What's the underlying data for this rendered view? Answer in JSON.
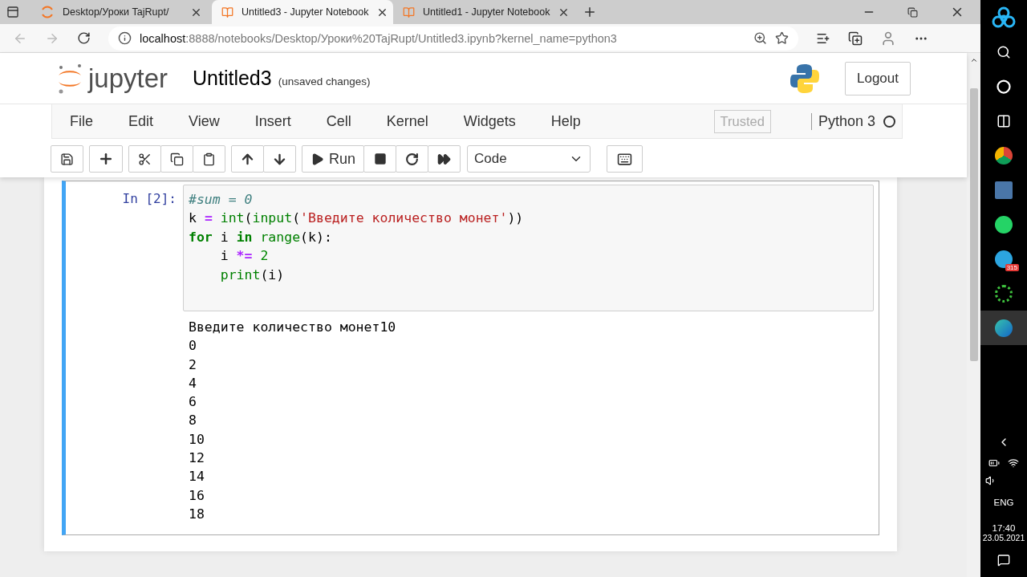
{
  "browser": {
    "tabs": [
      {
        "title": "Desktop/Уроки TajRupt/",
        "selected": false,
        "kind": "loading"
      },
      {
        "title": "Untitled3 - Jupyter Notebook",
        "selected": true,
        "kind": "notebook"
      },
      {
        "title": "Untitled1 - Jupyter Notebook",
        "selected": false,
        "kind": "notebook"
      }
    ],
    "url": {
      "host": "localhost",
      "rest": ":8888/notebooks/Desktop/Уроки%20TajRupt/Untitled3.ipynb?kernel_name=python3"
    }
  },
  "header": {
    "logo_text": "jupyter",
    "notebook_name": "Untitled3",
    "save_status": "(unsaved changes)",
    "logout": "Logout"
  },
  "menu": [
    "File",
    "Edit",
    "View",
    "Insert",
    "Cell",
    "Kernel",
    "Widgets",
    "Help"
  ],
  "trusted": "Trusted",
  "kernel": {
    "name": "Python 3",
    "busy": false
  },
  "toolbar": {
    "run": "Run",
    "cell_type": "Code"
  },
  "cell": {
    "prompt": "In [2]:",
    "selected": true,
    "code": [
      [
        {
          "kind": "comment",
          "text": "#sum = 0"
        }
      ],
      [
        {
          "kind": "plain",
          "text": "k "
        },
        {
          "kind": "operator",
          "text": "="
        },
        {
          "kind": "builtin",
          "text": " int"
        },
        {
          "kind": "plain",
          "text": "("
        },
        {
          "kind": "builtin",
          "text": "input"
        },
        {
          "kind": "plain",
          "text": "("
        },
        {
          "kind": "string",
          "text": "'Введите количество монет'"
        },
        {
          "kind": "plain",
          "text": "))"
        }
      ],
      [
        {
          "kind": "keyword",
          "text": "for"
        },
        {
          "kind": "plain",
          "text": " i "
        },
        {
          "kind": "keyword",
          "text": "in"
        },
        {
          "kind": "builtin",
          "text": " range"
        },
        {
          "kind": "plain",
          "text": "(k):"
        }
      ],
      [
        {
          "kind": "plain",
          "text": "    i "
        },
        {
          "kind": "operator",
          "text": "*="
        },
        {
          "kind": "number",
          "text": " 2"
        }
      ],
      [
        {
          "kind": "builtin",
          "text": "    print"
        },
        {
          "kind": "plain",
          "text": "(i)"
        }
      ]
    ],
    "output": [
      "Введите количество монет10",
      "0",
      "2",
      "4",
      "6",
      "8",
      "10",
      "12",
      "14",
      "16",
      "18"
    ]
  },
  "taskbar": {
    "telegram_badge": "315",
    "language": "ENG",
    "time": "17:40",
    "date": "23.05.2021"
  }
}
